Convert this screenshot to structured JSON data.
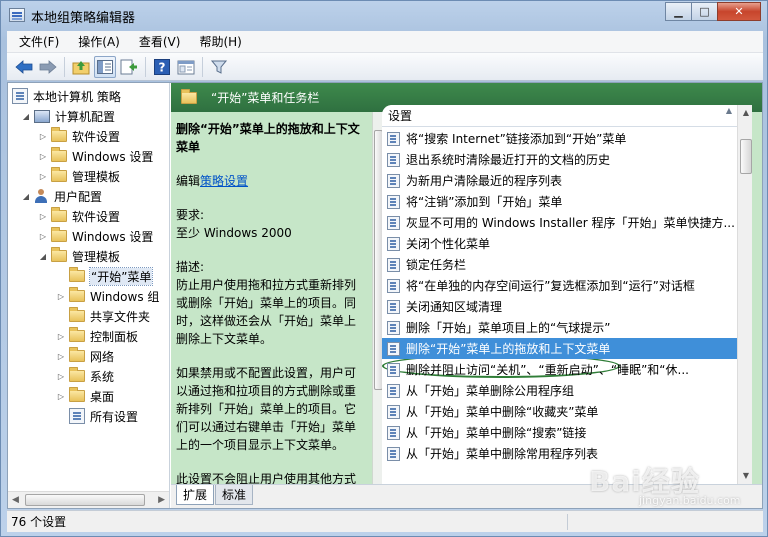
{
  "window": {
    "title": "本地组策略编辑器",
    "controls": {
      "minimize": "▁",
      "maximize": "□",
      "close": "✕"
    }
  },
  "menu": [
    "文件(F)",
    "操作(A)",
    "查看(V)",
    "帮助(H)"
  ],
  "toolbar": {
    "icons": [
      "back-arrow-icon",
      "forward-arrow-icon",
      "up-folder-icon",
      "show-hide-tree-icon",
      "export-list-icon",
      "help-icon",
      "properties-icon",
      "filter-icon"
    ]
  },
  "tree": {
    "items": [
      {
        "label": "本地计算机 策略",
        "icon": "policy-icon",
        "expander": ""
      },
      {
        "label": "计算机配置",
        "icon": "computer-icon",
        "expander": "◢"
      },
      {
        "label": "软件设置",
        "icon": "folder-icon",
        "expander": "▷"
      },
      {
        "label": "Windows 设置",
        "icon": "folder-icon",
        "expander": "▷"
      },
      {
        "label": "管理模板",
        "icon": "folder-icon",
        "expander": "▷"
      },
      {
        "label": "用户配置",
        "icon": "user-icon",
        "expander": "◢"
      },
      {
        "label": "软件设置",
        "icon": "folder-icon",
        "expander": "▷"
      },
      {
        "label": "Windows 设置",
        "icon": "folder-icon",
        "expander": "▷"
      },
      {
        "label": "管理模板",
        "icon": "folder-icon",
        "expander": "◢"
      },
      {
        "label": "“开始”菜单",
        "icon": "folder-icon",
        "expander": ""
      },
      {
        "label": "Windows 组",
        "icon": "folder-icon",
        "expander": "▷"
      },
      {
        "label": "共享文件夹",
        "icon": "folder-icon",
        "expander": ""
      },
      {
        "label": "控制面板",
        "icon": "folder-icon",
        "expander": "▷"
      },
      {
        "label": "网络",
        "icon": "folder-icon",
        "expander": "▷"
      },
      {
        "label": "系统",
        "icon": "folder-icon",
        "expander": "▷"
      },
      {
        "label": "桌面",
        "icon": "folder-icon",
        "expander": "▷"
      },
      {
        "label": "所有设置",
        "icon": "settings-list-icon",
        "expander": ""
      }
    ]
  },
  "right": {
    "header": "“开始”菜单和任务栏",
    "description": {
      "title": "删除“开始”菜单上的拖放和上下文菜单",
      "edit_prefix": "编辑",
      "edit_link": "策略设置",
      "requirement_label": "要求:",
      "requirement": "至少 Windows 2000",
      "desc_label": "描述:",
      "para1": "防止用户使用拖和拉方式重新排列或删除「开始」菜单上的项目。同时，这样做还会从「开始」菜单上删除上下文菜单。",
      "para2": "如果禁用或不配置此设置，用户可以通过拖和拉项目的方式删除或重新排列「开始」菜单上的项目。它们可以通过右键单击「开始」菜单上的一个项目显示上下文菜单。",
      "para3": "此设置不会阻止用户使用其他方式自定义「开始」菜单或从上下文菜"
    },
    "list": {
      "column_header": "设置",
      "rows": [
        "将“搜索 Internet”链接添加到“开始”菜单",
        "退出系统时清除最近打开的文档的历史",
        "为新用户清除最近的程序列表",
        "将“注销”添加到「开始」菜单",
        "灰显不可用的 Windows Installer 程序「开始」菜单快捷方...",
        "关闭个性化菜单",
        "锁定任务栏",
        "将“在单独的内存空间运行”复选框添加到“运行”对话框",
        "关闭通知区域清理",
        "删除「开始」菜单项目上的“气球提示”",
        "删除“开始”菜单上的拖放和上下文菜单",
        "删除并阻止访问“关机”、“重新启动”、“睡眠”和“休...",
        "从「开始」菜单删除公用程序组",
        "从「开始」菜单中删除“收藏夹”菜单",
        "从「开始」菜单中删除“搜索”链接",
        "从「开始」菜单中删除常用程序列表"
      ],
      "selected_index": 10
    },
    "tabs": [
      "扩展",
      "标准"
    ]
  },
  "status": "76 个设置",
  "watermark": {
    "brand": "Bai经验",
    "sub": "jingyan.baidu.com"
  }
}
